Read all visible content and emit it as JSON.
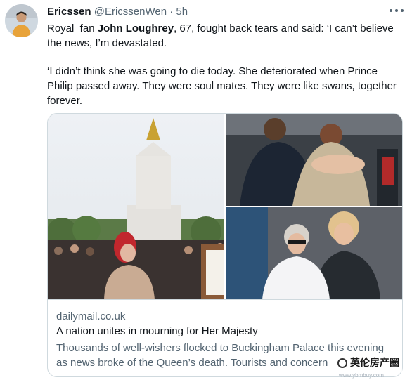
{
  "tweet": {
    "display_name": "Ericssen",
    "handle": "@EricssenWen",
    "separator": "·",
    "time": "5h",
    "text_part1": "Royal  fan ",
    "text_bold": "John Loughrey",
    "text_part2": ", 67, fought back tears and said: ‘I can’t believe the news, I’m devastated.",
    "text_para2": "‘I didn’t think she was going to die today. She deteriorated when Prince Philip passed away. They were soul mates. They were like swans, together forever."
  },
  "card": {
    "domain": "dailymail.co.uk",
    "title": "A nation unites in mourning for Her Majesty",
    "description": "Thousands of well-wishers flocked to Buckingham Palace this evening as news broke of the Queen’s death. Tourists and concern"
  },
  "watermark": {
    "text": "英伦房产圈",
    "url": "www.ybmbuy.com"
  },
  "colors": {
    "text": "#0f1419",
    "secondary": "#536471",
    "border": "#cfd9de"
  }
}
